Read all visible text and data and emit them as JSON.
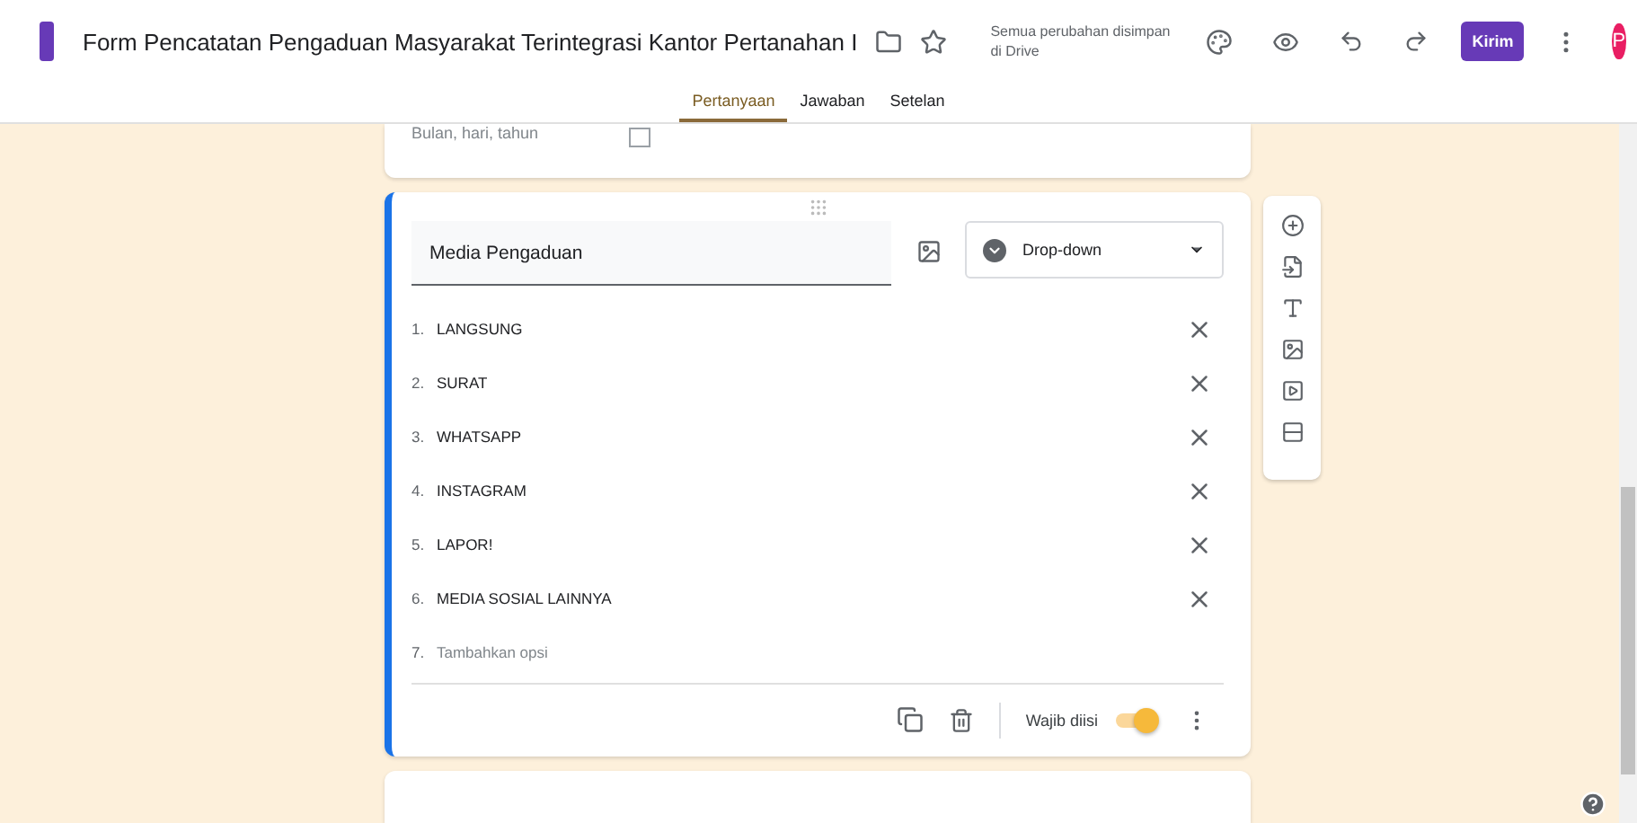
{
  "header": {
    "title": "Form Pencatatan Pengaduan Masyarakat Terintegrasi Kantor Pertanahan I",
    "save_status": [
      "Semua perubahan disimpan",
      "di Drive"
    ],
    "send_button": "Kirim",
    "avatar": "P"
  },
  "tabs": [
    {
      "label": "Pertanyaan",
      "selected": true
    },
    {
      "label": "Jawaban",
      "selected": false
    },
    {
      "label": "Setelan",
      "selected": false
    }
  ],
  "previous_question": {
    "placeholder": "Bulan, hari, tahun"
  },
  "question": {
    "title": "Media Pengaduan",
    "type": "Drop-down",
    "required": true,
    "required_label": "Wajib diisi",
    "options": [
      {
        "kind": "option",
        "number": "1.",
        "label": "LANGSUNG"
      },
      {
        "kind": "option",
        "number": "2.",
        "label": "SURAT"
      },
      {
        "kind": "option",
        "number": "3.",
        "label": "WHATSAPP"
      },
      {
        "kind": "option",
        "number": "4.",
        "label": "INSTAGRAM"
      },
      {
        "kind": "option",
        "number": "5.",
        "label": "LAPOR!"
      },
      {
        "kind": "option",
        "number": "6.",
        "label": "MEDIA SOSIAL LAINNYA"
      },
      {
        "kind": "add",
        "number": "7.",
        "label": "Tambahkan opsi"
      }
    ]
  }
}
